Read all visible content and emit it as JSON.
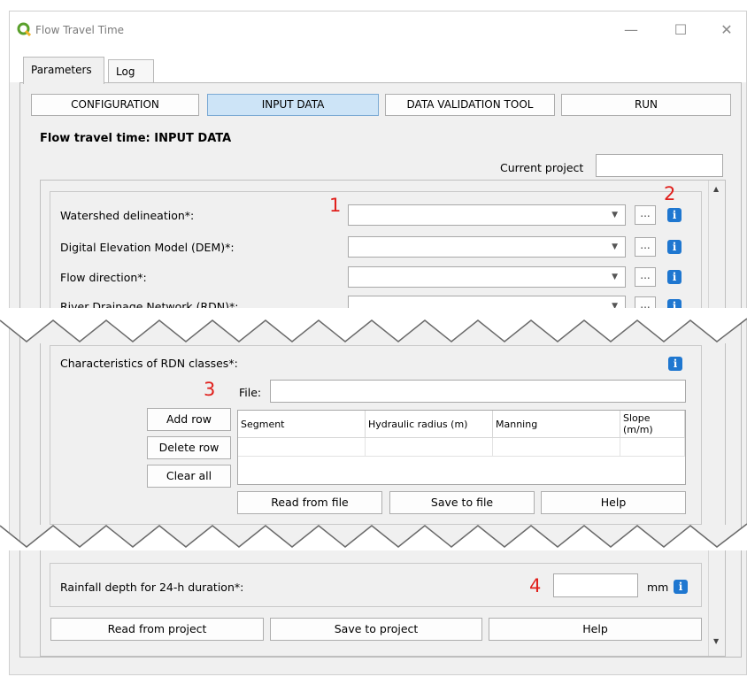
{
  "window": {
    "title": "Flow Travel Time",
    "minimize": "—",
    "maximize": "☐",
    "close": "✕"
  },
  "tabs": [
    {
      "label": "Parameters",
      "active": true
    },
    {
      "label": "Log",
      "active": false
    }
  ],
  "nav": {
    "configuration": "CONFIGURATION",
    "input_data": "INPUT DATA",
    "validation": "DATA VALIDATION TOOL",
    "run": "RUN"
  },
  "heading": "Flow travel time: INPUT DATA",
  "current_project": {
    "label": "Current project",
    "value": ""
  },
  "inputs": [
    {
      "label": "Watershed delineation*:",
      "value": ""
    },
    {
      "label": "Digital Elevation Model (DEM)*:",
      "value": ""
    },
    {
      "label": "Flow direction*:",
      "value": ""
    },
    {
      "label": "River Drainage Network (RDN)*:",
      "value": ""
    }
  ],
  "browse_label": "...",
  "info_glyph": "i",
  "annotations": {
    "n1": "1",
    "n2": "2",
    "n3": "3",
    "n4": "4"
  },
  "rdn": {
    "title": "Characteristics of RDN classes*:",
    "file_label": "File:",
    "file_value": "",
    "add_row": "Add row",
    "delete_row": "Delete row",
    "clear_all": "Clear all",
    "columns": [
      "Segment",
      "Hydraulic radius (m)",
      "Manning",
      "Slope (m/m)"
    ],
    "read_from_file": "Read from file",
    "save_to_file": "Save to file",
    "help": "Help"
  },
  "rainfall": {
    "label": "Rainfall depth for 24-h duration*:",
    "value": "",
    "unit": "mm"
  },
  "footer": {
    "read_from_project": "Read from project",
    "save_to_project": "Save to project",
    "help": "Help"
  },
  "colors": {
    "accent": "#1f77d0",
    "annotation": "#e0201c",
    "active_tab_button": "#cde4f7"
  }
}
